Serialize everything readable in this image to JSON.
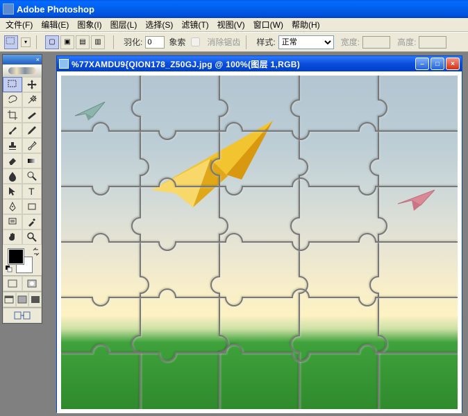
{
  "app": {
    "title": "Adobe Photoshop",
    "menus": [
      "文件(F)",
      "编辑(E)",
      "图象(I)",
      "图层(L)",
      "选择(S)",
      "滤镜(T)",
      "视图(V)",
      "窗口(W)",
      "帮助(H)"
    ]
  },
  "options": {
    "feather_label": "羽化:",
    "feather_value": "0",
    "feather_unit": "象索",
    "antialias_label": "消除锯齿",
    "style_label": "样式:",
    "style_value": "正常",
    "width_label": "宽度:",
    "height_label": "高度:"
  },
  "document": {
    "title": "%77XAMDU9{QION178_Z50GJ.jpg @ 100%(图层 1,RGB)"
  },
  "tools": {
    "row1": [
      "marquee",
      "move"
    ],
    "row2": [
      "lasso",
      "wand"
    ],
    "row3": [
      "crop",
      "slice"
    ],
    "row4": [
      "brush",
      "pencil"
    ],
    "row5": [
      "stamp",
      "history-brush"
    ],
    "row6": [
      "eraser",
      "gradient"
    ],
    "row7": [
      "blur",
      "dodge"
    ],
    "row8": [
      "path",
      "type"
    ],
    "row9": [
      "pen",
      "shape"
    ],
    "row10": [
      "notes",
      "eyedropper"
    ],
    "row11": [
      "hand",
      "zoom"
    ]
  },
  "colors": {
    "foreground": "#000000",
    "background": "#ffffff"
  }
}
